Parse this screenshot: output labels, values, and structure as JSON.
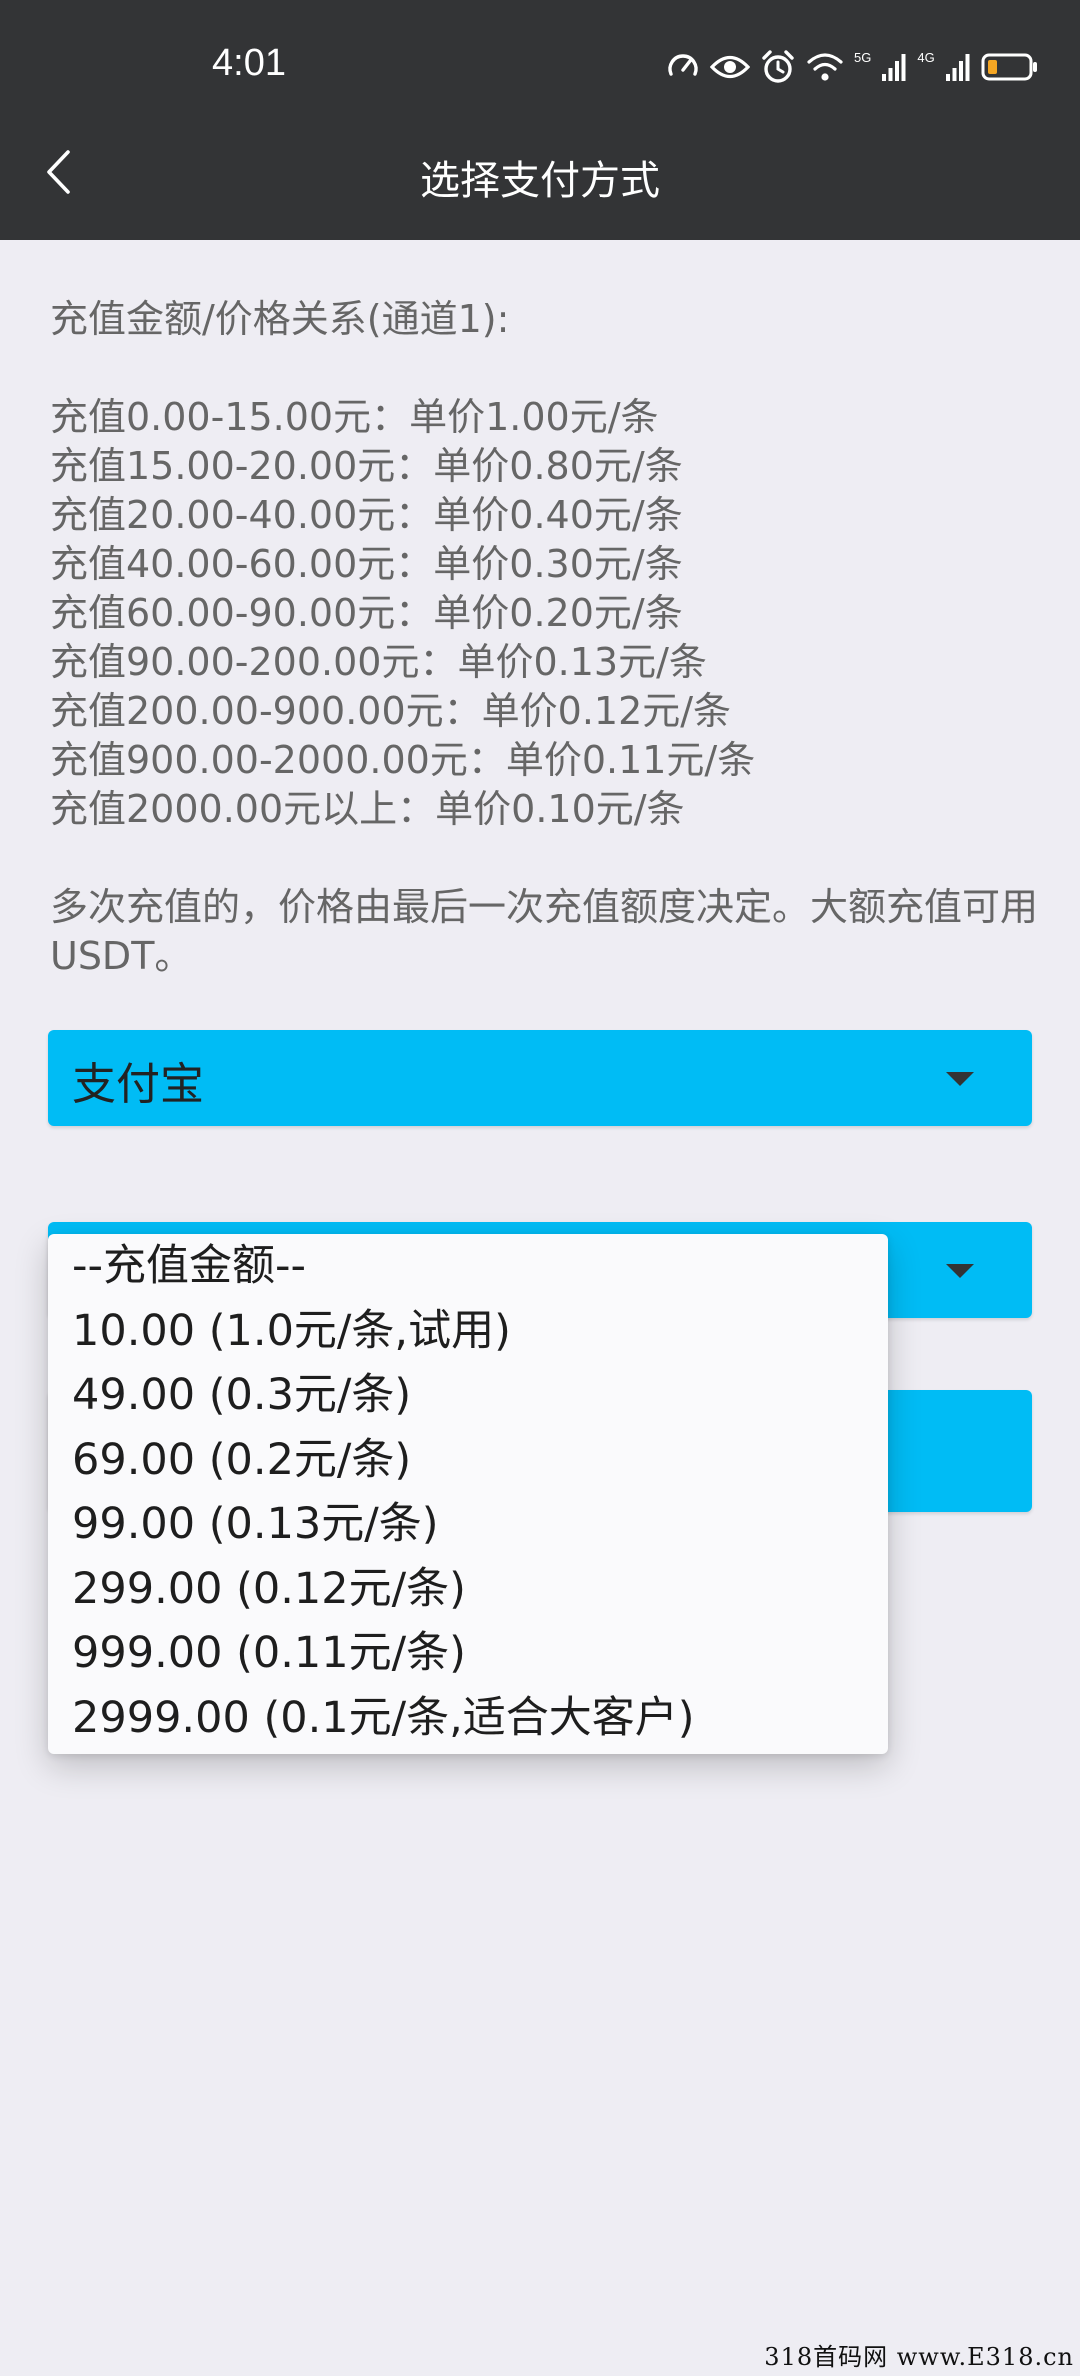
{
  "status_bar": {
    "time": "4:01",
    "network_5g": "5G",
    "network_4g": "4G",
    "icons": [
      "speedometer-icon",
      "eye-icon",
      "alarm-icon",
      "wifi-icon",
      "signal-icon",
      "signal-icon",
      "battery-icon"
    ],
    "battery_color": "#f5a623"
  },
  "header": {
    "back_icon": "chevron-left-icon",
    "title": "选择支付方式"
  },
  "pricing": {
    "heading": "充值金额/价格关系(通道1):",
    "tiers": [
      "充值0.00-15.00元：单价1.00元/条",
      "充值15.00-20.00元：单价0.80元/条",
      "充值20.00-40.00元：单价0.40元/条",
      "充值40.00-60.00元：单价0.30元/条",
      "充值60.00-90.00元：单价0.20元/条",
      "充值90.00-200.00元：单价0.13元/条",
      "充值200.00-900.00元：单价0.12元/条",
      "充值900.00-2000.00元：单价0.11元/条",
      "充值2000.00元以上：单价0.10元/条"
    ],
    "note": "多次充值的，价格由最后一次充值额度决定。大额充值可用USDT。"
  },
  "payment_select": {
    "selected": "支付宝"
  },
  "amount_dropdown": {
    "options": [
      "--充值金额--",
      "10.00 (1.0元/条,试用)",
      "49.00 (0.3元/条)",
      "69.00 (0.2元/条)",
      "99.00 (0.13元/条)",
      "299.00 (0.12元/条)",
      "999.00 (0.11元/条)",
      "2999.00 (0.1元/条,适合大客户)"
    ]
  },
  "colors": {
    "accent": "#00bcf5",
    "header_bg": "#333436",
    "page_bg": "#eeedf3",
    "body_text": "#666666"
  },
  "watermark": "318首码网 www.E318.cn"
}
